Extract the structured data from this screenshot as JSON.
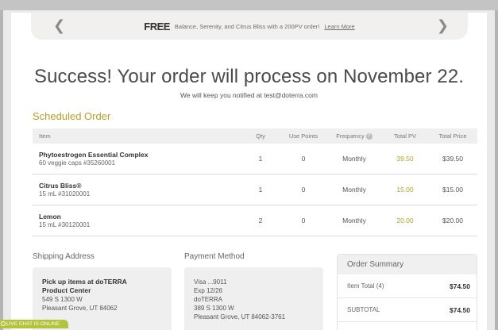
{
  "promo": {
    "prev_icon": "chevron-left-icon",
    "next_icon": "chevron-right-icon",
    "free_label": "FREE",
    "text": "Balance, Serenity, and Citrus Bliss with a 200PV order!",
    "link": "Learn More"
  },
  "headline": "Success! Your order will process on November 22.",
  "subline": "We will keep you notified at test@doterra.com",
  "section_title": "Scheduled Order",
  "table": {
    "headers": {
      "item": "Item",
      "qty": "Qty",
      "points": "Use Points",
      "frequency": "Frequency",
      "pv": "Total PV",
      "price": "Total Price"
    },
    "rows": [
      {
        "name": "Phytoestrogen Essential Complex",
        "sub": "60 veggie caps #35260001",
        "qty": "1",
        "points": "0",
        "frequency": "Monthly",
        "pv": "39.50",
        "price": "$39.50"
      },
      {
        "name": "Citrus Bliss®",
        "sub": "15 mL #31020001",
        "qty": "1",
        "points": "0",
        "frequency": "Monthly",
        "pv": "15.00",
        "price": "$15.00"
      },
      {
        "name": "Lemon",
        "sub": "15 mL #30120001",
        "qty": "2",
        "points": "0",
        "frequency": "Monthly",
        "pv": "20.00",
        "price": "$20.00"
      }
    ]
  },
  "shipping": {
    "label": "Shipping Address",
    "line1": "Pick up items at doTERRA",
    "line2": "Product Center",
    "line3": "549 S 1300 W",
    "line4": "Pleasant Grove, UT 84062"
  },
  "payment": {
    "label": "Payment Method",
    "line1": "Visa ...9011",
    "line2": "Exp 12/26",
    "line3": "doTERRA",
    "line4": "389 S 1300 W",
    "line5": "Pleasant Grove, UT 84062-3761"
  },
  "summary": {
    "title": "Order Summary",
    "item_total_label": "Item Total (4)",
    "item_total_value": "$74.50",
    "subtotal_label": "SUBTOTAL",
    "subtotal_value": "$74.50"
  },
  "live_chat": "LIVE CHAT IS ONLINE",
  "colors": {
    "accent_gold": "#b5a02a",
    "chat_green": "#b3c43a"
  }
}
